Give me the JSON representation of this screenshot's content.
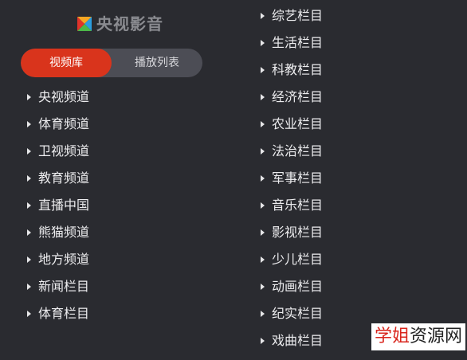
{
  "logo": {
    "text": "央视影音",
    "icon": "cctv-play-logo-icon",
    "colors": [
      "#f6a623",
      "#2a9de0",
      "#4cb748",
      "#e0332a"
    ]
  },
  "tabs": [
    {
      "label": "视频库",
      "active": true
    },
    {
      "label": "播放列表",
      "active": false
    }
  ],
  "left_list": [
    {
      "label": "央视频道"
    },
    {
      "label": "体育频道"
    },
    {
      "label": "卫视频道"
    },
    {
      "label": "教育频道"
    },
    {
      "label": "直播中国"
    },
    {
      "label": "熊猫频道"
    },
    {
      "label": "地方频道"
    },
    {
      "label": "新闻栏目"
    },
    {
      "label": "体育栏目"
    }
  ],
  "right_list": [
    {
      "label": "综艺栏目"
    },
    {
      "label": "生活栏目"
    },
    {
      "label": "科教栏目"
    },
    {
      "label": "经济栏目"
    },
    {
      "label": "农业栏目"
    },
    {
      "label": "法治栏目"
    },
    {
      "label": "军事栏目"
    },
    {
      "label": "音乐栏目"
    },
    {
      "label": "影视栏目"
    },
    {
      "label": "少儿栏目"
    },
    {
      "label": "动画栏目"
    },
    {
      "label": "纪实栏目"
    },
    {
      "label": "戏曲栏目"
    }
  ],
  "watermark": {
    "part1": "学姐",
    "part2": "资源网"
  },
  "colors": {
    "background": "#2a2b30",
    "accent": "#d9341c",
    "tab_inactive": "#4c4d55"
  }
}
